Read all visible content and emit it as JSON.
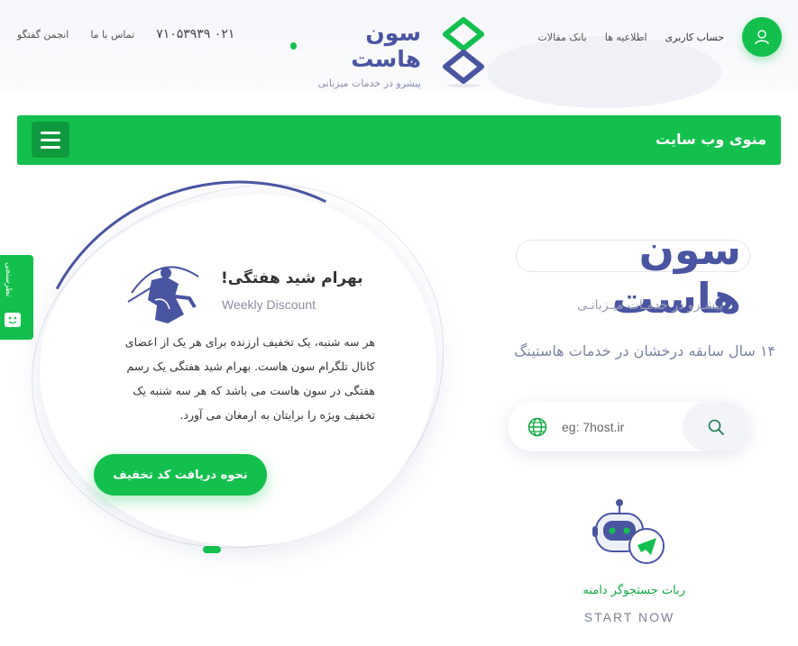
{
  "header": {
    "forum_label": "انجمن گفتگو",
    "contact_label": "تماس با ما",
    "phone": "۰۲۱ ۷۱۰۵۳۹۳۹",
    "brand_name": "سون هاست",
    "brand_tagline": "پیشرو در خدمات میزبانی",
    "articles_label": "بانک مقالات",
    "news_label": "اطلاعیه ها",
    "account_label": "حساب کاربری"
  },
  "menubar": {
    "title": "منوی وب سایت"
  },
  "sidetab": {
    "label": "نظرسنجی"
  },
  "card": {
    "title": "بهرام شید هفتگی!",
    "subtitle": "Weekly Discount",
    "body": "هر سه شنبه، یک تخفیف ارزنده برای هر یک از اعضای کانال تلگرام سون هاست. بهرام شید هفتگی یک رسم هفتگی در سون هاست می باشد که هر سه شنبه یک تخفیف ویژه را برایتان به ارمغان می آورد.",
    "button_label": "نحوه دریافت کد تخفیف"
  },
  "hero": {
    "name": "سون هاست",
    "tagline": "پیشـرو در خدمـات میـزبانـی",
    "experience": "۱۴ سال سابقه درخشان در خدمات هاستینگ"
  },
  "search": {
    "placeholder": "eg: 7host.ir",
    "value": ""
  },
  "bot": {
    "label": "ربات جستجوگر دامنه",
    "cta": "START NOW"
  },
  "colors": {
    "accent": "#13c04e",
    "brand": "#4a55a2"
  },
  "icons": {
    "user": "user-icon",
    "menu": "hamburger-icon",
    "globe": "globe-icon",
    "search": "search-icon",
    "bot": "robot-icon",
    "telegram": "telegram-icon",
    "smile": "smile-icon",
    "logo": "logo-icon"
  }
}
